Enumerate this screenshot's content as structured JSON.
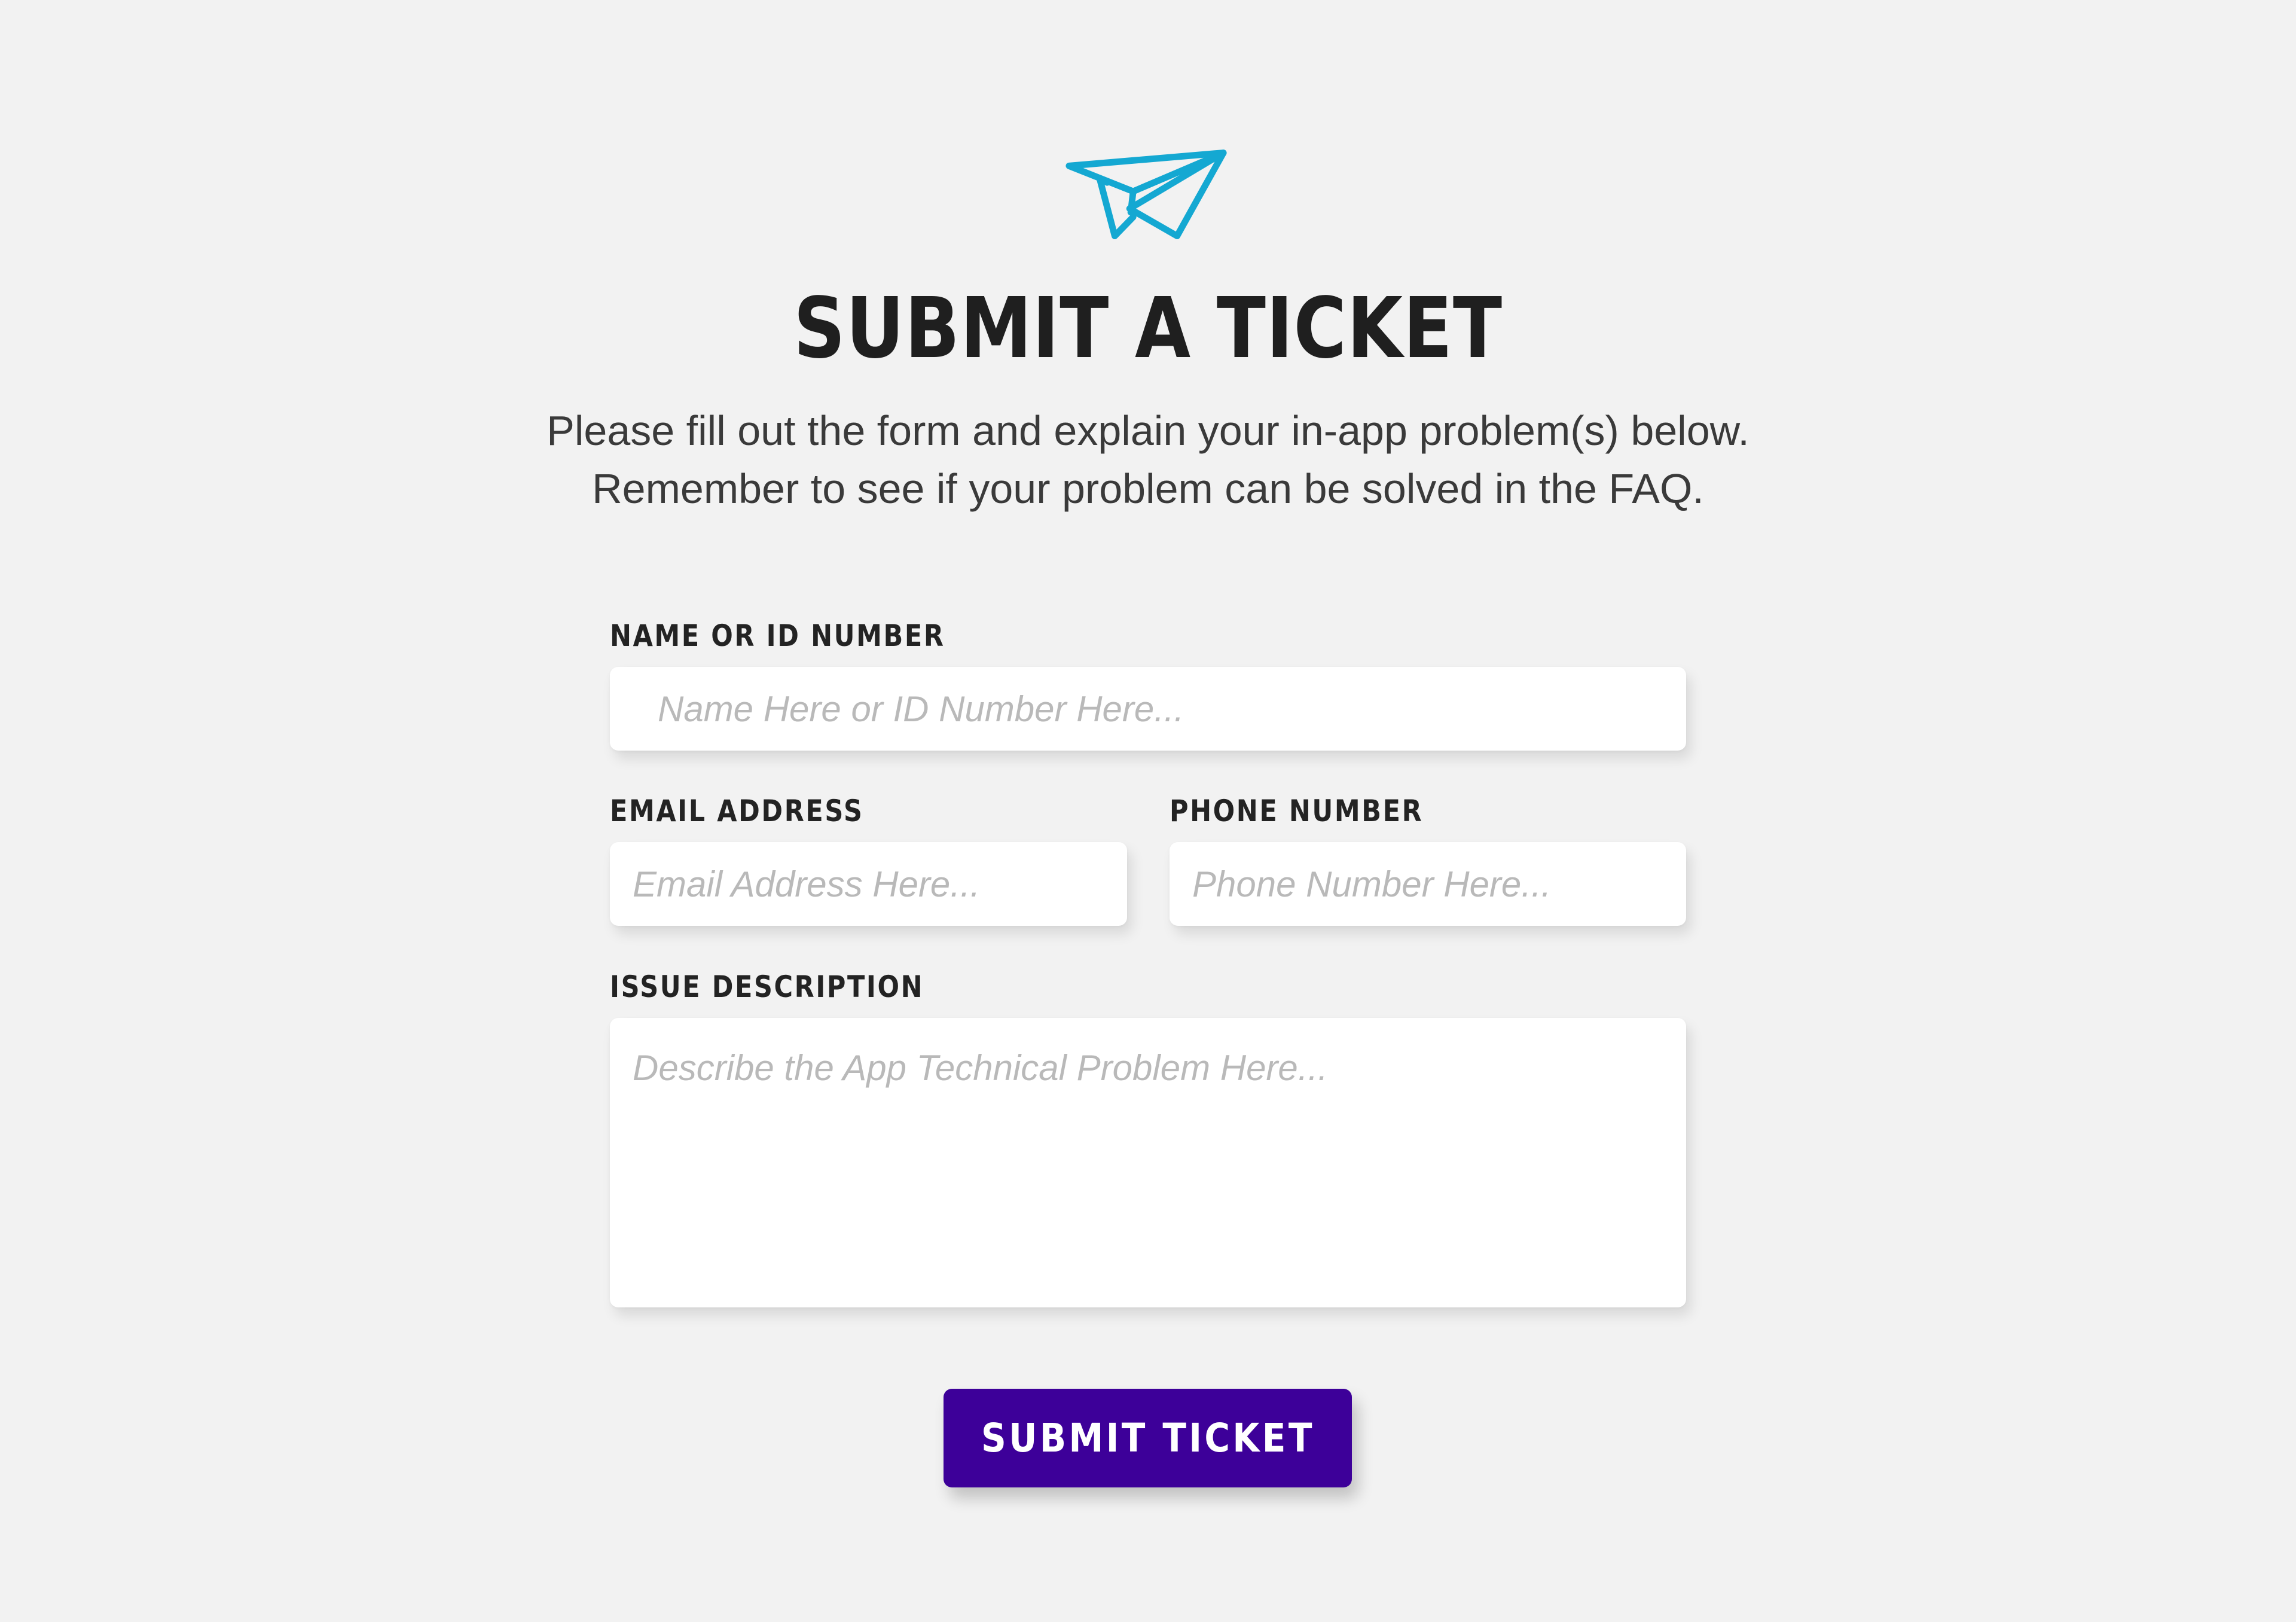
{
  "header": {
    "icon": "paper-plane-icon",
    "title": "SUBMIT A TICKET",
    "subtitle_line1": "Please fill out the form and explain your in-app problem(s) below.",
    "subtitle_line2": "Remember to see if your problem can be solved in the FAQ."
  },
  "form": {
    "name_label": "NAME OR ID NUMBER",
    "name_placeholder": "Name Here or ID Number Here...",
    "email_label": "EMAIL ADDRESS",
    "email_placeholder": "Email Address Here...",
    "phone_label": "PHONE NUMBER",
    "phone_placeholder": "Phone Number Here...",
    "issue_label": "ISSUE DESCRIPTION",
    "issue_placeholder": "Describe the App Technical Problem Here...",
    "submit_label": "SUBMIT TICKET"
  },
  "colors": {
    "background": "#f2f2f2",
    "icon": "#14a8d2",
    "accent": "#3d0099",
    "title_text": "#1f1f1f",
    "placeholder": "#b9b9b9"
  }
}
